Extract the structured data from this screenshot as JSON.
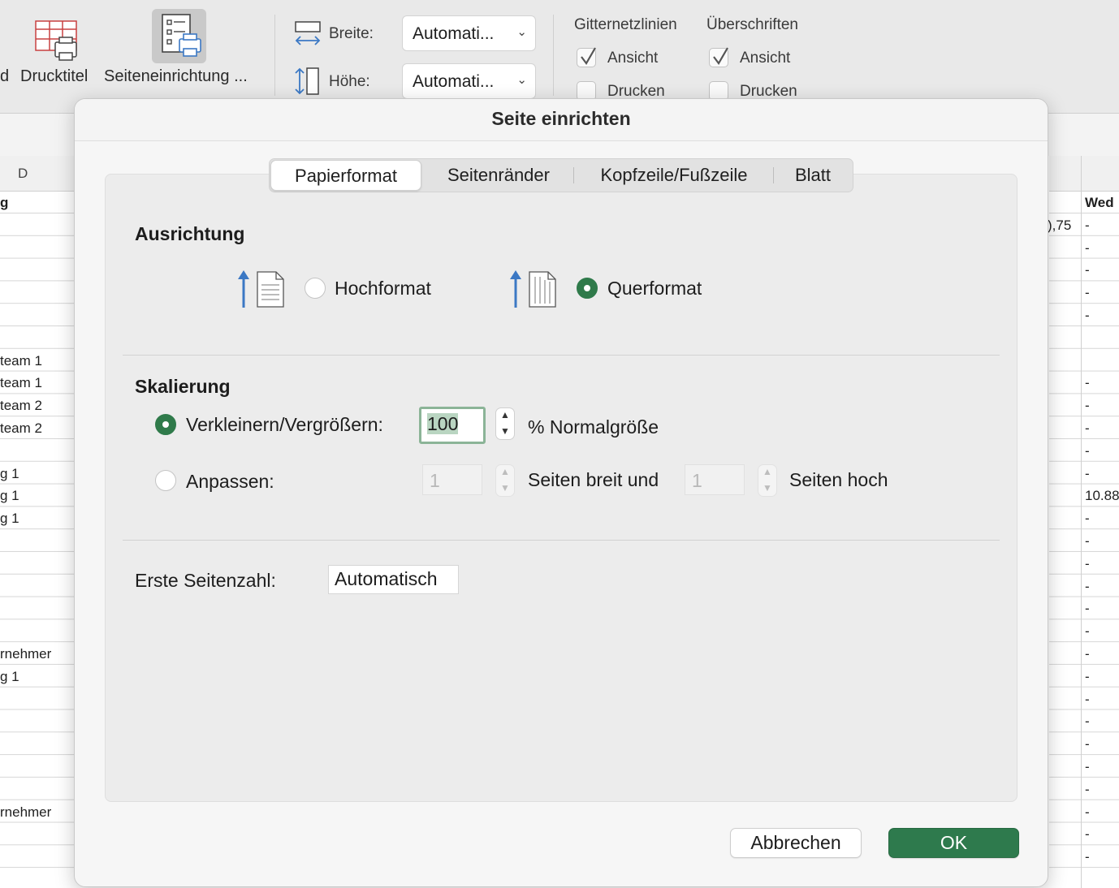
{
  "ribbon": {
    "cut_label": "d",
    "print_titles": "Drucktitel",
    "page_setup": "Seiteneinrichtung ...",
    "width_label": "Breite:",
    "width_value": "Automati...",
    "height_label": "Höhe:",
    "height_value": "Automati...",
    "gridlines": {
      "title": "Gitternetzlinien",
      "view": "Ansicht",
      "view_checked": true,
      "print": "Drucken",
      "print_checked": false
    },
    "headings": {
      "title": "Überschriften",
      "view": "Ansicht",
      "view_checked": true,
      "print": "Drucken",
      "print_checked": false
    }
  },
  "sheet": {
    "col_d": "D",
    "header_left": "g",
    "header_right": "Wed",
    "left_cells": [
      {
        "row": 7,
        "text": "team 1"
      },
      {
        "row": 8,
        "text": "team 1"
      },
      {
        "row": 9,
        "text": "team 2"
      },
      {
        "row": 10,
        "text": "team 2"
      },
      {
        "row": 12,
        "text": "g 1"
      },
      {
        "row": 13,
        "text": "g 1"
      },
      {
        "row": 14,
        "text": "g 1"
      },
      {
        "row": 20,
        "text": "rnehmer"
      },
      {
        "row": 21,
        "text": "g 1"
      },
      {
        "row": 27,
        "text": "rnehmer"
      }
    ],
    "right_number_row1": "),75",
    "right_special": {
      "row": 13,
      "text": "10.88"
    },
    "dash": "-",
    "dash_rows": [
      1,
      2,
      3,
      4,
      5,
      8,
      9,
      10,
      11,
      12,
      14,
      15,
      16,
      17,
      18,
      19,
      20,
      21,
      22,
      23,
      24,
      25,
      26,
      27,
      28,
      29
    ]
  },
  "dialog": {
    "title": "Seite einrichten",
    "tabs": [
      "Papierformat",
      "Seitenränder",
      "Kopfzeile/Fußzeile",
      "Blatt"
    ],
    "active_tab": "Papierformat",
    "orientation": {
      "title": "Ausrichtung",
      "portrait": "Hochformat",
      "landscape": "Querformat",
      "selected": "Querformat"
    },
    "scaling": {
      "title": "Skalierung",
      "adjust_label": "Verkleinern/Vergrößern:",
      "adjust_value": "100",
      "adjust_suffix": "% Normalgröße",
      "fit_label": "Anpassen:",
      "fit_wide": "1",
      "fit_wide_suffix": "Seiten breit und",
      "fit_tall": "1",
      "fit_tall_suffix": "Seiten hoch",
      "selected": "adjust"
    },
    "first_page": {
      "label": "Erste Seitenzahl:",
      "value": "Automatisch"
    },
    "cancel": "Abbrechen",
    "ok": "OK"
  },
  "colors": {
    "accent_green": "#2e7a4d",
    "focus_ring": "#8bb497",
    "ribbon_bg": "#e9e9e9",
    "icon_blue": "#3b78c4"
  }
}
